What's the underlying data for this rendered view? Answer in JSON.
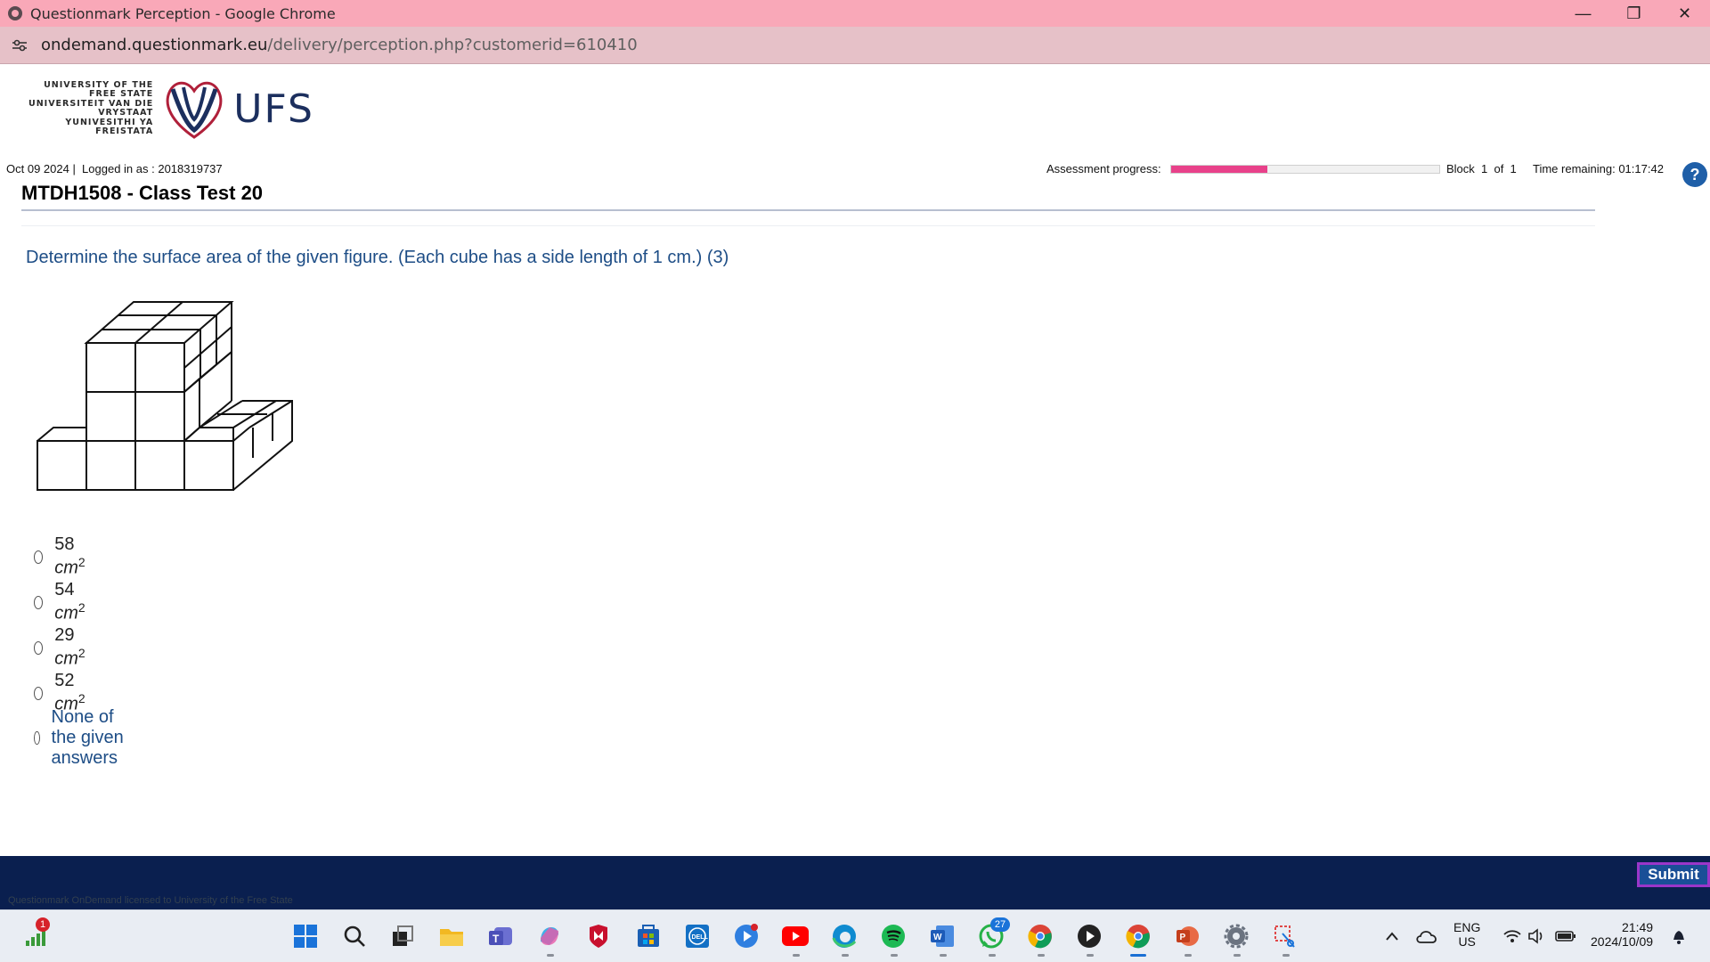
{
  "browser": {
    "window_title": "Questionmark Perception - Google Chrome",
    "url_host": "ondemand.questionmark.eu",
    "url_path": "/delivery/perception.php?customerid=610410"
  },
  "logo": {
    "lines": [
      "UNIVERSITY OF THE",
      "FREE STATE",
      "UNIVERSITEIT VAN DIE",
      "VRYSTAAT",
      "YUNIVESITHI YA",
      "FREISTATA"
    ],
    "abbr": "UFS",
    "brand_color": "#1c2f5e",
    "accent_color": "#b0203a"
  },
  "info": {
    "date": "Oct 09 2024",
    "logged_in": "Logged in as : 2018319737",
    "progress_label": "Assessment progress:",
    "progress_fraction": 0.36,
    "block_text": "Block  1  of  1",
    "time_remaining": "Time remaining: 01:17:42"
  },
  "test": {
    "title": "MTDH1508 - Class Test 20",
    "question": "Determine the surface area of the given figure. (Each cube has a side length of 1 cm.) (3)",
    "options": [
      {
        "value": "58",
        "unit": "cm",
        "exp": "2"
      },
      {
        "value": "54",
        "unit": "cm",
        "exp": "2"
      },
      {
        "value": "29",
        "unit": "cm",
        "exp": "2"
      },
      {
        "value": "52",
        "unit": "cm",
        "exp": "2"
      }
    ],
    "option_none": "None of the given answers"
  },
  "footer": {
    "submit_label": "Submit",
    "license": "Questionmark OnDemand licensed to University of the Free State"
  },
  "taskbar": {
    "signal_badge": "1",
    "whatsapp_badge": "27",
    "lang_line1": "ENG",
    "lang_line2": "US",
    "clock_time": "21:49",
    "clock_date": "2024/10/09"
  },
  "colors": {
    "titlebar": "#f9a8b8",
    "addressbar": "#e6c1c8",
    "question_text": "#1d4d86",
    "progress_fill": "#e8418a",
    "footer": "#0a1f4f",
    "submit": "#1a4f97"
  }
}
